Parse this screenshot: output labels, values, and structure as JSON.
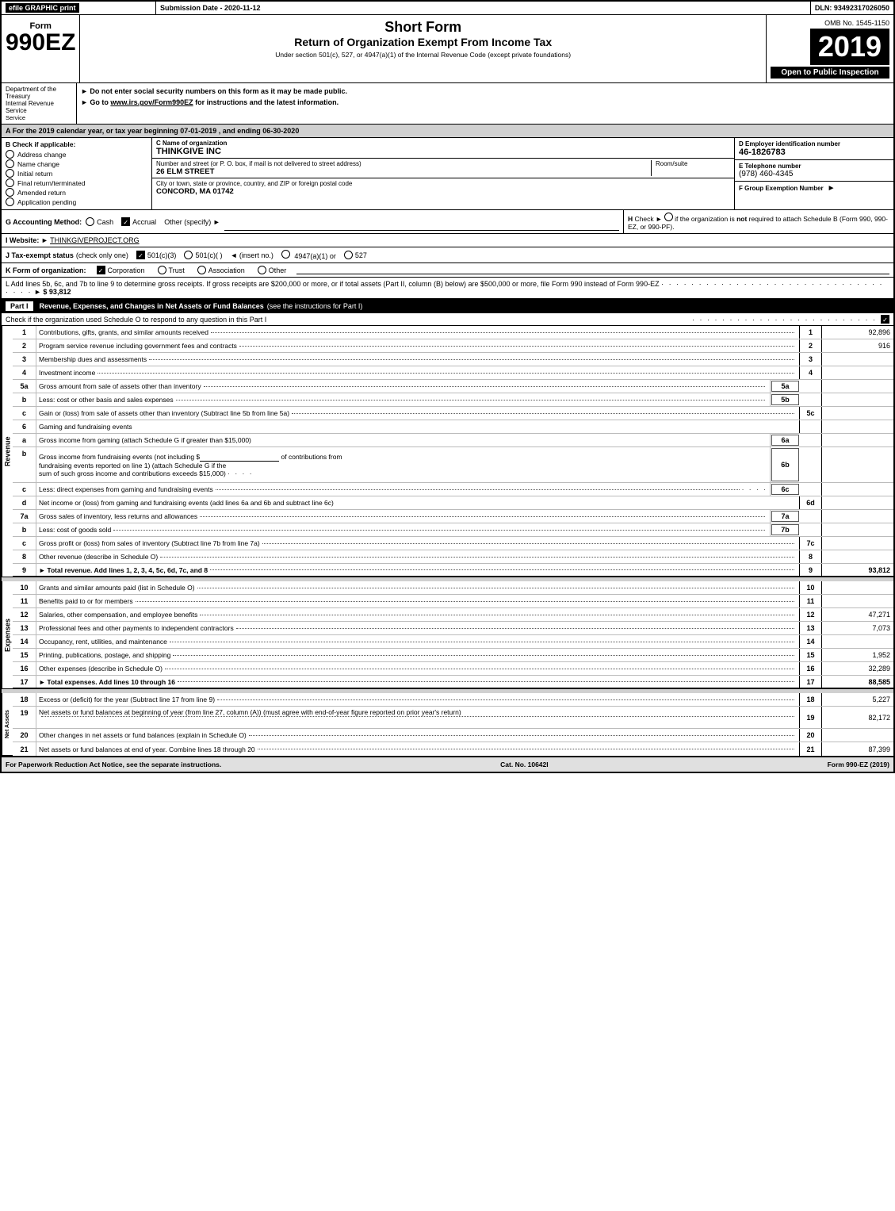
{
  "header": {
    "efile_label": "efile GRAPHIC print",
    "submission_label": "Submission Date - 2020-11-12",
    "dln_label": "DLN: 93492317026050",
    "omb_label": "OMB No. 1545-1150",
    "form_number": "990EZ",
    "short_form": "Short Form",
    "return_title": "Return of Organization Exempt From Income Tax",
    "under_section": "Under section 501(c), 527, or 4947(a)(1) of the Internal Revenue Code (except private foundations)",
    "ssn_notice": "► Do not enter social security numbers on this form as it may be made public.",
    "goto_notice": "► Go to www.irs.gov/Form990EZ for instructions and the latest information.",
    "year": "2019",
    "open_to_public": "Open to Public Inspection",
    "dept_line1": "Department of the Treasury",
    "dept_line2": "Internal Revenue Service"
  },
  "section_a": {
    "text": "A  For the 2019 calendar year, or tax year beginning 07-01-2019 , and ending 06-30-2020"
  },
  "section_b": {
    "label": "B  Check if applicable:",
    "checkboxes": [
      {
        "label": "Address change",
        "checked": false
      },
      {
        "label": "Name change",
        "checked": false
      },
      {
        "label": "Initial return",
        "checked": false
      },
      {
        "label": "Final return/terminated",
        "checked": false
      },
      {
        "label": "Amended return",
        "checked": false
      },
      {
        "label": "Application pending",
        "checked": false
      }
    ],
    "c_label": "C Name of organization",
    "org_name": "THINKGIVE INC",
    "street_label": "Number and street (or P. O. box, if mail is not delivered to street address)",
    "street_value": "26 ELM STREET",
    "room_label": "Room/suite",
    "room_value": "",
    "city_label": "City or town, state or province, country, and ZIP or foreign postal code",
    "city_value": "CONCORD, MA  01742",
    "d_label": "D Employer identification number",
    "ein": "46-1826783",
    "e_label": "E Telephone number",
    "phone": "(978) 460-4345",
    "f_label": "F Group Exemption Number",
    "group_num": ""
  },
  "section_g": {
    "label": "G Accounting Method:",
    "cash_label": "Cash",
    "cash_checked": false,
    "accrual_label": "Accrual",
    "accrual_checked": true,
    "other_label": "Other (specify) ►"
  },
  "section_h": {
    "text": "H  Check ►  O if the organization is not required to attach Schedule B (Form 990, 990-EZ, or 990-PF)."
  },
  "section_i": {
    "label": "I Website: ►",
    "url": "THINKGIVEPROJECT.ORG"
  },
  "section_j": {
    "label": "J Tax-exempt status",
    "check_note": "(check only one)",
    "options": [
      {
        "label": "501(c)(3)",
        "checked": true
      },
      {
        "label": "501(c)(  )",
        "checked": false
      },
      {
        "label": "(insert no.)"
      },
      {
        "label": "4947(a)(1) or"
      },
      {
        "label": "527",
        "checked": false
      }
    ]
  },
  "section_k": {
    "label": "K Form of organization:",
    "options": [
      {
        "label": "Corporation",
        "checked": true
      },
      {
        "label": "Trust",
        "checked": false
      },
      {
        "label": "Association",
        "checked": false
      },
      {
        "label": "Other",
        "checked": false
      }
    ]
  },
  "section_l": {
    "text": "L Add lines 5b, 6c, and 7b to line 9 to determine gross receipts. If gross receipts are $200,000 or more, or if total assets (Part II, column (B) below) are $500,000 or more, file Form 990 instead of Form 990-EZ",
    "dots": "· · · · · · · · · · · · · · · · · · · · · · · · · · · · · · · · · ·",
    "amount": "► $ 93,812"
  },
  "part1": {
    "label": "Part I",
    "title": "Revenue, Expenses, and Changes in Net Assets or Fund Balances",
    "see_instructions": "(see the instructions for Part I)",
    "schedule_o_text": "Check if the organization used Schedule O to respond to any question in this Part I",
    "checkbox_checked": true,
    "revenue_label": "Revenue",
    "rows": [
      {
        "num": "1",
        "desc": "Contributions, gifts, grants, and similar amounts received",
        "dots": true,
        "line_num": "1",
        "amount": "92,896"
      },
      {
        "num": "2",
        "desc": "Program service revenue including government fees and contracts",
        "dots": true,
        "line_num": "2",
        "amount": "916"
      },
      {
        "num": "3",
        "desc": "Membership dues and assessments",
        "dots": true,
        "line_num": "3",
        "amount": ""
      },
      {
        "num": "4",
        "desc": "Investment income",
        "dots": true,
        "line_num": "4",
        "amount": ""
      },
      {
        "num": "5a",
        "desc": "Gross amount from sale of assets other than inventory",
        "dots": true,
        "ref": "5a",
        "line_num": "",
        "amount": ""
      },
      {
        "num": "b",
        "desc": "Less: cost or other basis and sales expenses",
        "dots": true,
        "ref": "5b",
        "line_num": "",
        "amount": ""
      },
      {
        "num": "c",
        "desc": "Gain or (loss) from sale of assets other than inventory (Subtract line 5b from line 5a)",
        "dots": true,
        "line_num": "5c",
        "amount": ""
      },
      {
        "num": "6",
        "desc": "Gaming and fundraising events",
        "dots": false,
        "line_num": "",
        "amount": ""
      },
      {
        "num": "a",
        "desc": "Gross income from gaming (attach Schedule G if greater than $15,000)",
        "ref": "6a",
        "dots": false,
        "line_num": "",
        "amount": ""
      },
      {
        "num": "b",
        "desc": "Gross income from fundraising events (not including $",
        "desc2": " of contributions from fundraising events reported on line 1) (attach Schedule G if the sum of such gross income and contributions exceeds $15,000)",
        "ref": "6b",
        "line_num": "",
        "amount": ""
      },
      {
        "num": "c",
        "desc": "Less: direct expenses from gaming and fundraising events",
        "ref": "6c",
        "dots": true,
        "line_num": "",
        "amount": ""
      },
      {
        "num": "d",
        "desc": "Net income or (loss) from gaming and fundraising events (add lines 6a and 6b and subtract line 6c)",
        "dots": false,
        "line_num": "6d",
        "amount": ""
      },
      {
        "num": "7a",
        "desc": "Gross sales of inventory, less returns and allowances",
        "dots": true,
        "ref": "7a",
        "line_num": "",
        "amount": ""
      },
      {
        "num": "b",
        "desc": "Less: cost of goods sold",
        "dots": true,
        "ref": "7b",
        "line_num": "",
        "amount": ""
      },
      {
        "num": "c",
        "desc": "Gross profit or (loss) from sales of inventory (Subtract line 7b from line 7a)",
        "dots": true,
        "line_num": "7c",
        "amount": ""
      },
      {
        "num": "8",
        "desc": "Other revenue (describe in Schedule O)",
        "dots": true,
        "line_num": "8",
        "amount": ""
      },
      {
        "num": "9",
        "desc": "Total revenue. Add lines 1, 2, 3, 4, 5c, 6d, 7c, and 8",
        "dots": true,
        "line_num": "9",
        "amount": "93,812",
        "bold": true,
        "arrow": "►"
      }
    ]
  },
  "expenses": {
    "label": "Expenses",
    "rows": [
      {
        "num": "10",
        "desc": "Grants and similar amounts paid (list in Schedule O)",
        "dots": true,
        "line_num": "10",
        "amount": ""
      },
      {
        "num": "11",
        "desc": "Benefits paid to or for members",
        "dots": true,
        "line_num": "11",
        "amount": ""
      },
      {
        "num": "12",
        "desc": "Salaries, other compensation, and employee benefits",
        "dots": true,
        "line_num": "12",
        "amount": "47,271"
      },
      {
        "num": "13",
        "desc": "Professional fees and other payments to independent contractors",
        "dots": true,
        "line_num": "13",
        "amount": "7,073"
      },
      {
        "num": "14",
        "desc": "Occupancy, rent, utilities, and maintenance",
        "dots": true,
        "line_num": "14",
        "amount": ""
      },
      {
        "num": "15",
        "desc": "Printing, publications, postage, and shipping",
        "dots": true,
        "line_num": "15",
        "amount": "1,952"
      },
      {
        "num": "16",
        "desc": "Other expenses (describe in Schedule O)",
        "dots": true,
        "line_num": "16",
        "amount": "32,289"
      },
      {
        "num": "17",
        "desc": "Total expenses. Add lines 10 through 16",
        "dots": true,
        "line_num": "17",
        "amount": "88,585",
        "bold": true,
        "arrow": "►"
      }
    ]
  },
  "net_assets": {
    "label": "Net Assets",
    "rows": [
      {
        "num": "18",
        "desc": "Excess or (deficit) for the year (Subtract line 17 from line 9)",
        "dots": true,
        "line_num": "18",
        "amount": "5,227"
      },
      {
        "num": "19",
        "desc": "Net assets or fund balances at beginning of year (from line 27, column (A)) (must agree with end-of-year figure reported on prior year's return)",
        "dots": true,
        "line_num": "19",
        "amount": "82,172"
      },
      {
        "num": "20",
        "desc": "Other changes in net assets or fund balances (explain in Schedule O)",
        "dots": true,
        "line_num": "20",
        "amount": ""
      },
      {
        "num": "21",
        "desc": "Net assets or fund balances at end of year. Combine lines 18 through 20",
        "dots": true,
        "line_num": "21",
        "amount": "87,399"
      }
    ]
  },
  "footer": {
    "left": "For Paperwork Reduction Act Notice, see the separate instructions.",
    "cat": "Cat. No. 10642I",
    "right": "Form 990-EZ (2019)"
  }
}
